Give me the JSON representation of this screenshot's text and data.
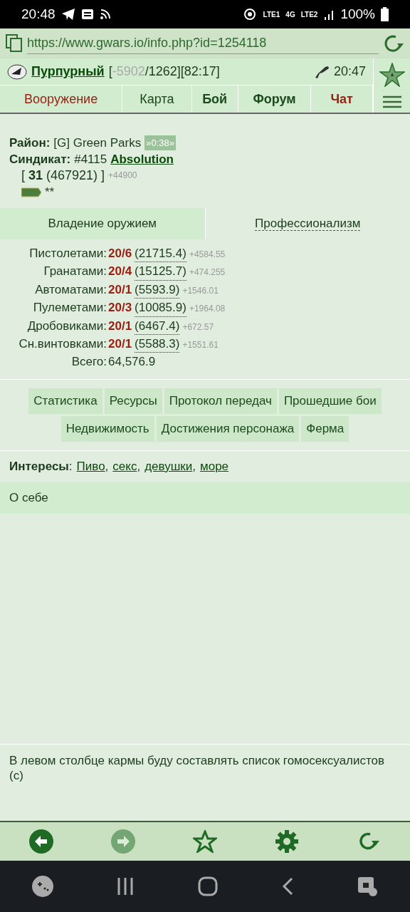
{
  "status_bar": {
    "time": "20:48",
    "network_labels": [
      "LTE1",
      "4G",
      "LTE2"
    ],
    "battery": "100%"
  },
  "browser": {
    "url": "https://www.gwars.io/info.php?id=1254118"
  },
  "header": {
    "name": "Пурпурный",
    "stats_open": "[",
    "stats_neg": "-5902",
    "stats_rest": "/1262][82:17]",
    "time": "20:47"
  },
  "nav": [
    {
      "label": "Вооружение",
      "kind": "red"
    },
    {
      "label": "Карта",
      "kind": "plain"
    },
    {
      "label": "Бой",
      "kind": "bold"
    },
    {
      "label": "Форум",
      "kind": "bold"
    },
    {
      "label": "Чат",
      "kind": "redbold"
    }
  ],
  "info": {
    "district_label": "Район:",
    "district": "[G] Green Parks",
    "district_badge": "»0:38»",
    "syndicate_label": "Синдикат:",
    "syndicate_num": "#4115",
    "syndicate_name": "Absolution",
    "level_open": "[",
    "level": "31",
    "level_points": "(467921) ]",
    "level_gain": "+44900",
    "rank_stars": "**"
  },
  "tabs": [
    {
      "label": "Владение оружием",
      "selected": true
    },
    {
      "label": "Профессионализм",
      "selected": false
    }
  ],
  "skills": [
    {
      "name": "Пистолетами:",
      "level": "20/6",
      "points": "(21715.4)",
      "gain": "+4584.55"
    },
    {
      "name": "Гранатами:",
      "level": "20/4",
      "points": "(15125.7)",
      "gain": "+474.255"
    },
    {
      "name": "Автоматами:",
      "level": "20/1",
      "points": "(5593.9)",
      "gain": "+1546.01"
    },
    {
      "name": "Пулеметами:",
      "level": "20/3",
      "points": "(10085.9)",
      "gain": "+1964.08"
    },
    {
      "name": "Дробовиками:",
      "level": "20/1",
      "points": "(6467.4)",
      "gain": "+672.57"
    },
    {
      "name": "Сн.винтовками:",
      "level": "20/1",
      "points": "(5588.3)",
      "gain": "+1551.61"
    }
  ],
  "total": {
    "label": "Всего:",
    "value": "64,576.9"
  },
  "links": [
    [
      "Статистика",
      "Ресурсы",
      "Протокол передач",
      "Прошедшие бои"
    ],
    [
      "Недвижимость",
      "Достижения персонажа",
      "Ферма"
    ]
  ],
  "interests": {
    "label": "Интересы",
    "colon": ":",
    "items": [
      {
        "text": "Пиво",
        "sep": ","
      },
      {
        "text": "секс",
        "sep": ","
      },
      {
        "text": "девушки",
        "sep": ","
      },
      {
        "text": "море"
      }
    ]
  },
  "about": {
    "title": "О себе",
    "quote": "В левом столбце кармы буду составлять список гомосексуалистов (с)"
  }
}
